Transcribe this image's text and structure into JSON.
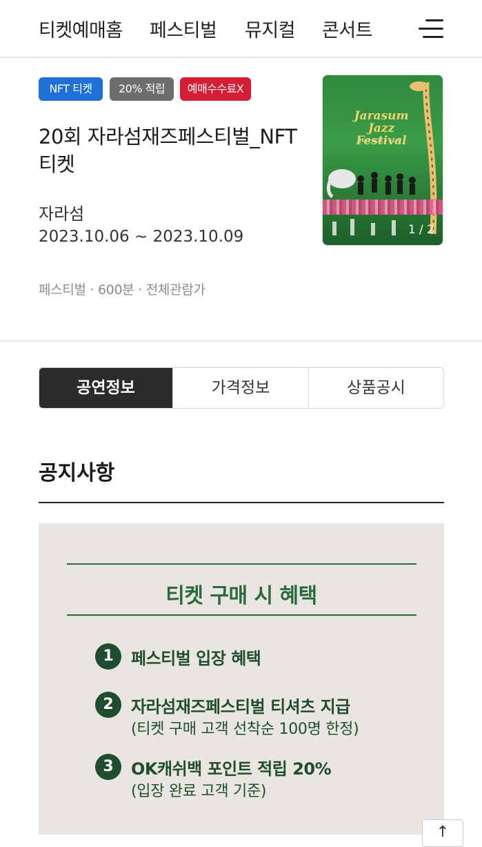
{
  "nav": {
    "items": [
      "티켓예매홈",
      "페스티벌",
      "뮤지컬",
      "콘서트"
    ],
    "menu_icon": "hamburger-menu-icon"
  },
  "product": {
    "badges": [
      "NFT 티켓",
      "20% 적립",
      "예매수수료X"
    ],
    "title": "20회 자라섬재즈페스티벌_NFT 티켓",
    "venue": "자라섬",
    "dates": "2023.10.06 ~ 2023.10.09",
    "meta": "페스티벌 · 600분  · 전체관람가",
    "poster": {
      "title_line1": "Jarasum",
      "title_line2": "Jazz Festival",
      "subtitle": "2023.10.06 ~ 10.09",
      "counter": "1 / 2"
    }
  },
  "tabs": [
    {
      "label": "공연정보",
      "active": true
    },
    {
      "label": "가격정보",
      "active": false
    },
    {
      "label": "상품공시",
      "active": false
    }
  ],
  "notice": {
    "section_title": "공지사항",
    "heading": "티켓 구매 시 혜택",
    "benefits": [
      {
        "num": "1",
        "main": "페스티벌 입장 혜택",
        "sub": ""
      },
      {
        "num": "2",
        "main": "자라섬재즈페스티벌 티셔츠 지급",
        "sub": "(티켓 구매 고객 선착순 100명 한정)"
      },
      {
        "num": "3",
        "main": "OK캐쉬백 포인트 적립 20%",
        "sub": "(입장 완료 고객 기준)"
      }
    ]
  },
  "scroll_top_icon": "arrow-up-icon",
  "colors": {
    "badge_blue": "#1e6fd6",
    "badge_gray": "#6d6d6d",
    "badge_red": "#d51d33",
    "notice_green": "#2a6a3e",
    "active_tab": "#2b2b2b"
  }
}
